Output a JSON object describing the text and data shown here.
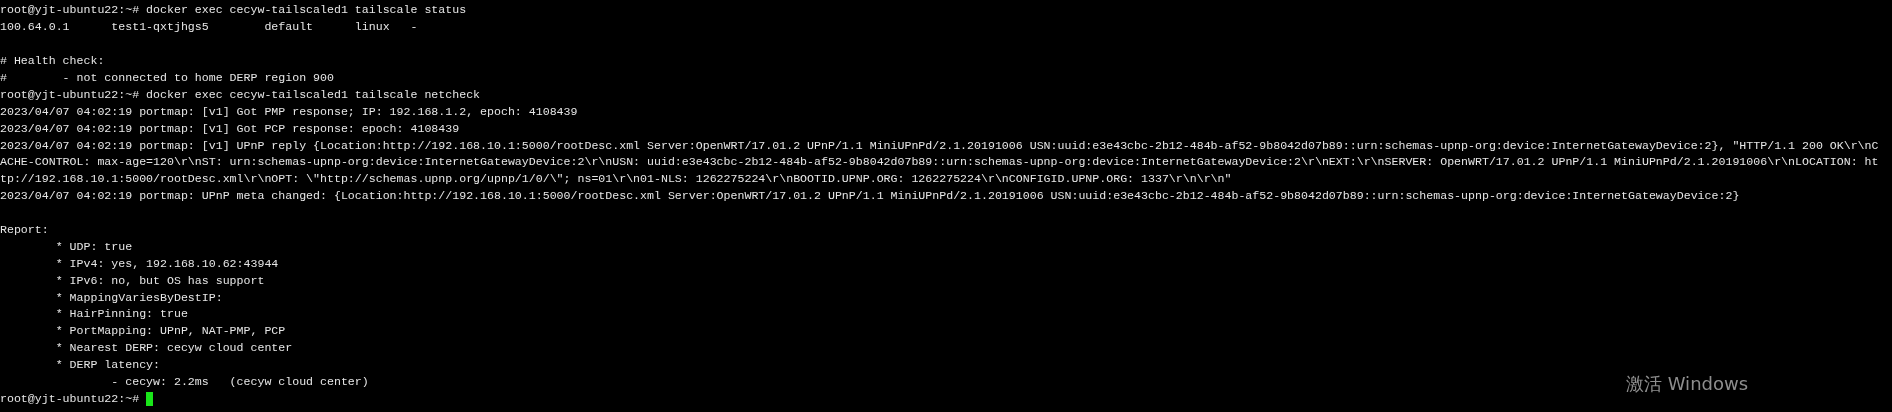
{
  "terminal": {
    "blocks": [
      [
        "root@yjt-ubuntu22:~# docker exec cecyw-tailscaled1 tailscale status",
        "100.64.0.1      test1-qxtjhgs5        default      linux   -"
      ],
      [
        "# Health check:",
        "#        - not connected to home DERP region 900",
        "root@yjt-ubuntu22:~# docker exec cecyw-tailscaled1 tailscale netcheck",
        "2023/04/07 04:02:19 portmap: [v1] Got PMP response; IP: 192.168.1.2, epoch: 4108439",
        "2023/04/07 04:02:19 portmap: [v1] Got PCP response: epoch: 4108439",
        "2023/04/07 04:02:19 portmap: [v1] UPnP reply {Location:http://192.168.10.1:5000/rootDesc.xml Server:OpenWRT/17.01.2 UPnP/1.1 MiniUPnPd/2.1.20191006 USN:uuid:e3e43cbc-2b12-484b-af52-9b8042d07b89::urn:schemas-upnp-org:device:InternetGatewayDevice:2}, \"HTTP/1.1 200 OK\\r\\nC",
        "ACHE-CONTROL: max-age=120\\r\\nST: urn:schemas-upnp-org:device:InternetGatewayDevice:2\\r\\nUSN: uuid:e3e43cbc-2b12-484b-af52-9b8042d07b89::urn:schemas-upnp-org:device:InternetGatewayDevice:2\\r\\nEXT:\\r\\nSERVER: OpenWRT/17.01.2 UPnP/1.1 MiniUPnPd/2.1.20191006\\r\\nLOCATION: ht",
        "tp://192.168.10.1:5000/rootDesc.xml\\r\\nOPT: \\\"http://schemas.upnp.org/upnp/1/0/\\\"; ns=01\\r\\n01-NLS: 1262275224\\r\\nBOOTID.UPNP.ORG: 1262275224\\r\\nCONFIGID.UPNP.ORG: 1337\\r\\n\\r\\n\"",
        "2023/04/07 04:02:19 portmap: UPnP meta changed: {Location:http://192.168.10.1:5000/rootDesc.xml Server:OpenWRT/17.01.2 UPnP/1.1 MiniUPnPd/2.1.20191006 USN:uuid:e3e43cbc-2b12-484b-af52-9b8042d07b89::urn:schemas-upnp-org:device:InternetGatewayDevice:2}"
      ],
      [
        "Report:",
        "        * UDP: true",
        "        * IPv4: yes, 192.168.10.62:43944",
        "        * IPv6: no, but OS has support",
        "        * MappingVariesByDestIP:",
        "        * HairPinning: true",
        "        * PortMapping: UPnP, NAT-PMP, PCP",
        "        * Nearest DERP: cecyw cloud center",
        "        * DERP latency:",
        "                - cecyw: 2.2ms   (cecyw cloud center)",
        "root@yjt-ubuntu22:~#"
      ]
    ],
    "cursor": true
  },
  "os_overlay": {
    "title": "激活 Windows"
  }
}
